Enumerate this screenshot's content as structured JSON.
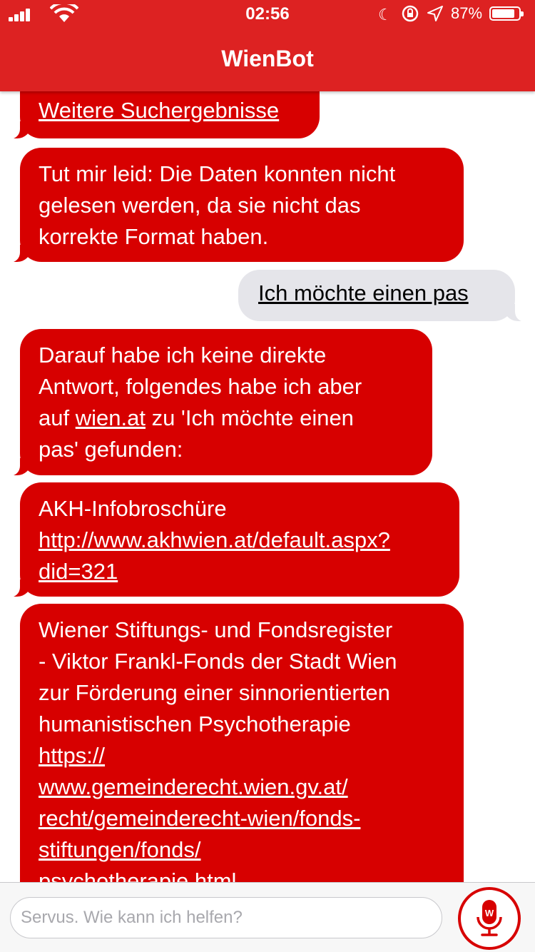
{
  "status_bar": {
    "time": "02:56",
    "battery_percent": "87%",
    "battery_level": 0.87
  },
  "header": {
    "title": "WienBot"
  },
  "messages": [
    {
      "sender": "bot",
      "lines": [
        "Weitere Suchergebnisse"
      ]
    },
    {
      "sender": "bot",
      "lines": [
        "Tut mir leid: Die Daten konnten nicht",
        "gelesen werden, da sie nicht das",
        "korrekte Format haben."
      ]
    },
    {
      "sender": "user",
      "lines": [
        "Ich möchte einen pas"
      ]
    },
    {
      "sender": "bot",
      "line1": "Darauf habe ich keine direkte",
      "line2": "Antwort, folgendes habe ich aber",
      "line3_pre": "auf ",
      "line3_link": "wien.at",
      "line3_post": " zu 'Ich möchte einen",
      "line4": "pas' gefunden:"
    },
    {
      "sender": "bot",
      "title": "AKH-Infobroschüre",
      "link_lines": [
        "http://www.akhwien.at/default.aspx?",
        "did=321"
      ]
    },
    {
      "sender": "bot",
      "title_lines": [
        "Wiener Stiftungs- und Fondsregister",
        "- Viktor Frankl-Fonds der Stadt Wien",
        "zur Förderung einer sinnorientierten",
        "humanistischen Psychotherapie"
      ],
      "link_lines": [
        "https://",
        "www.gemeinderecht.wien.gv.at/",
        "recht/gemeinderecht-wien/fonds-",
        "stiftungen/fonds/",
        "psychotherapie.html"
      ]
    }
  ],
  "composer": {
    "placeholder": "Servus. Wie kann ich helfen?",
    "mic_icon": "microphone-icon"
  },
  "colors": {
    "header_red": "#dd2222",
    "bot_bubble": "#d70000",
    "user_bubble": "#e5e5ea"
  }
}
